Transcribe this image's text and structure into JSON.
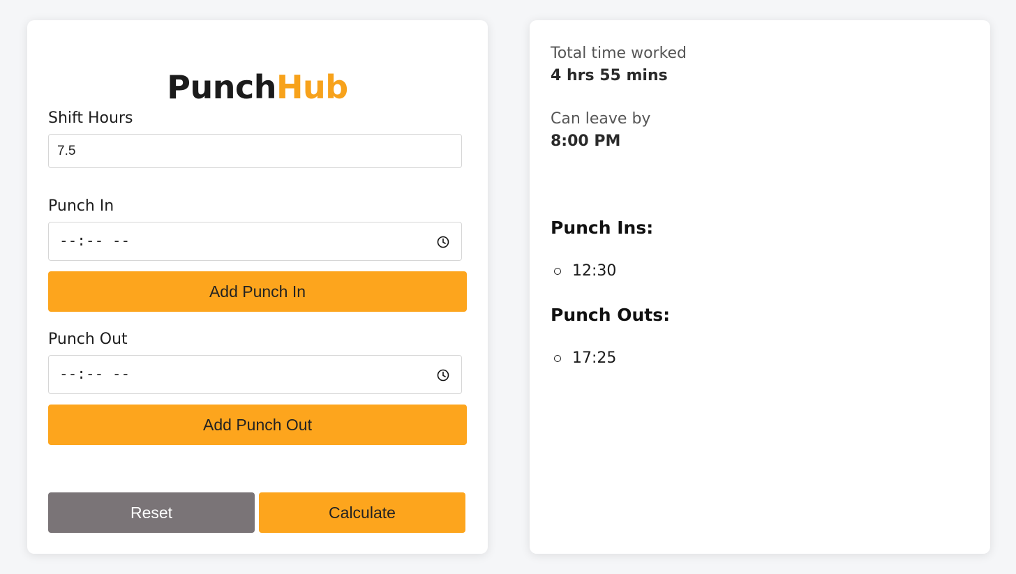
{
  "brand": {
    "part1": "Punch",
    "part2": "Hub"
  },
  "form": {
    "shift_hours_label": "Shift Hours",
    "shift_hours_value": "7.5",
    "punch_in_label": "Punch In",
    "punch_in_placeholder": "--:-- --",
    "add_punch_in_label": "Add Punch In",
    "punch_out_label": "Punch Out",
    "punch_out_placeholder": "--:-- --",
    "add_punch_out_label": "Add Punch Out",
    "reset_label": "Reset",
    "calculate_label": "Calculate"
  },
  "results": {
    "total_label": "Total time worked",
    "total_value": "4 hrs 55 mins",
    "leave_label": "Can leave by",
    "leave_value": "8:00 PM",
    "punch_ins_heading": "Punch Ins:",
    "punch_ins": [
      "12:30"
    ],
    "punch_outs_heading": "Punch Outs:",
    "punch_outs": [
      "17:25"
    ]
  },
  "icons": {
    "time_picker": "clock-icon",
    "list_bullet": "hollow-circle-bullet"
  },
  "colors": {
    "accent": "#fda51d",
    "brand_accent": "#f7a21b",
    "reset": "#7a7477",
    "background": "#f5f6f8",
    "card": "#ffffff"
  }
}
